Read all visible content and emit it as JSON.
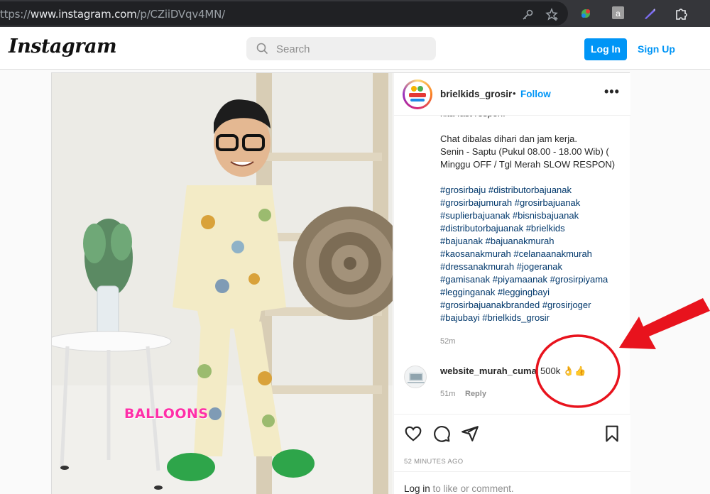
{
  "browser": {
    "url_prefix": "ttps://",
    "url_host": "www.instagram.com",
    "url_path": "/p/CZiiDVqv4MN/",
    "ext_badge": "a"
  },
  "header": {
    "logo_text": "Instagram",
    "search_placeholder": "Search",
    "login_label": "Log In",
    "signup_label": "Sign Up"
  },
  "post": {
    "username": "brielkids_grosir",
    "separator": "•",
    "follow_label": "Follow",
    "more_label": "•••",
    "caption_lines": [
      {
        "text": "kita fast respon.",
        "tag": false
      },
      {
        "text": "",
        "tag": false
      },
      {
        "text": "Chat dibalas dihari dan jam kerja.",
        "tag": false
      },
      {
        "text": "Senin - Saptu (Pukul 08.00 - 18.00 Wib) (",
        "tag": false
      },
      {
        "text": "Minggu OFF / Tgl Merah SLOW RESPON)",
        "tag": false
      },
      {
        "text": "",
        "tag": false
      },
      {
        "text": "#grosirbaju #distributorbajuanak",
        "tag": true
      },
      {
        "text": "#grosirbajumurah #grosirbajuanak",
        "tag": true
      },
      {
        "text": "#suplierbajuanak #bisnisbajuanak",
        "tag": true
      },
      {
        "text": "#distributorbajuanak #brielkids",
        "tag": true
      },
      {
        "text": "#bajuanak #bajuanakmurah",
        "tag": true
      },
      {
        "text": "#kaosanakmurah #celanaanakmurah",
        "tag": true
      },
      {
        "text": "#dressanakmurah #jogeranak",
        "tag": true
      },
      {
        "text": "#gamisanak #piyamaanak #grosirpiyama",
        "tag": true
      },
      {
        "text": "#legginganak #leggingbayi",
        "tag": true
      },
      {
        "text": "#grosirbajuanakbranded #grosirjoger",
        "tag": true
      },
      {
        "text": "#bajubayi #brielkids_grosir",
        "tag": true
      }
    ],
    "caption_time": "52m",
    "comment": {
      "username": "website_murah_cuma",
      "text": "500k 👌👍",
      "time": "51m",
      "reply_label": "Reply"
    },
    "time_ago": "52 MINUTES AGO",
    "login_prompt_link": "Log in",
    "login_prompt_rest": " to like or comment.",
    "watermark": "BALLOONS"
  },
  "colors": {
    "accent_blue": "#0095f6",
    "annotation_red": "#e8131d",
    "hashtag": "#00376b"
  },
  "icons": [
    "search-icon",
    "key-icon",
    "star-add-icon",
    "extension-icon",
    "heart-icon",
    "comment-icon",
    "share-icon",
    "bookmark-icon"
  ]
}
